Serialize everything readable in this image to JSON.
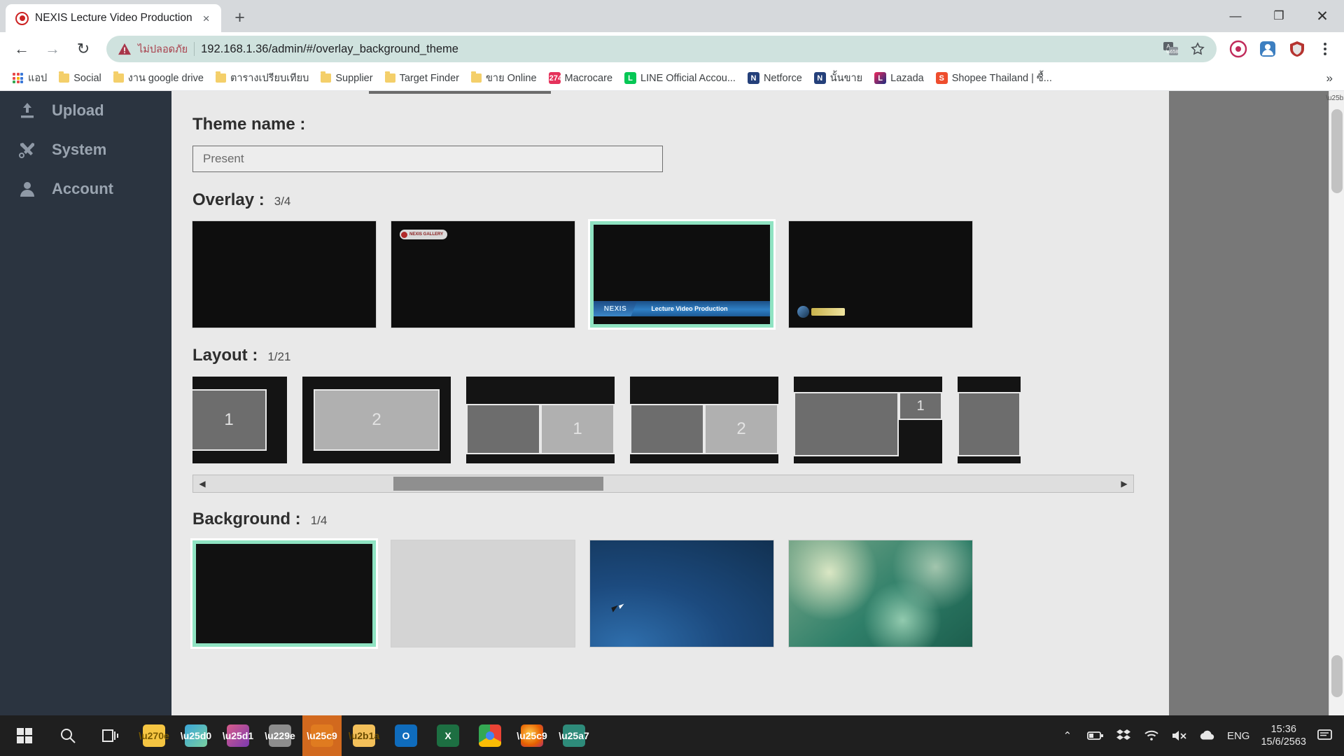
{
  "browser": {
    "tab": {
      "title": "NEXIS Lecture Video Production",
      "favicon": "record-circle-icon",
      "close": "×"
    },
    "new_tab_label": "+",
    "window_controls": {
      "minimize": "—",
      "maximize": "❐",
      "close": "✕"
    },
    "nav": {
      "back": "←",
      "forward": "→",
      "reload": "↻"
    },
    "omnibox": {
      "warning_text": "ไม่ปลอดภัย",
      "url": "192.168.1.36/admin/#/overlay_background_theme",
      "translate_icon": "translate-icon",
      "bookmark_icon": "star-icon"
    },
    "toolbar_right": {
      "ext1": "extension-icon",
      "ext2": "profile-icon",
      "ext3": "shield-icon",
      "menu": "three-dots-icon"
    },
    "bookmarks": [
      {
        "label": "แอป",
        "icon": "apps-grid-icon",
        "color": "#e84a4a"
      },
      {
        "label": "Social",
        "icon": "folder-icon",
        "color": "#f4cf6a"
      },
      {
        "label": "งาน google drive",
        "icon": "folder-icon",
        "color": "#f4cf6a"
      },
      {
        "label": "ตารางเปรียบเทียบ",
        "icon": "folder-icon",
        "color": "#f4cf6a"
      },
      {
        "label": "Supplier",
        "icon": "folder-icon",
        "color": "#f4cf6a"
      },
      {
        "label": "Target Finder",
        "icon": "folder-icon",
        "color": "#f4cf6a"
      },
      {
        "label": "ขาย Online",
        "icon": "folder-icon",
        "color": "#f4cf6a"
      },
      {
        "label": "Macrocare",
        "icon": "macrocare-icon",
        "color": "#e5325b"
      },
      {
        "label": "LINE Official Accou...",
        "icon": "line-icon",
        "color": "#06c755"
      },
      {
        "label": "Netforce",
        "icon": "netforce-icon",
        "color": "#3b5striple"
      },
      {
        "label": "นั้นขาย",
        "icon": "netforce-icon",
        "color": "#2d4a7a"
      },
      {
        "label": "Lazada",
        "icon": "lazada-icon",
        "color": "#f0285a"
      },
      {
        "label": "Shopee Thailand | ซื้...",
        "icon": "shopee-icon",
        "color": "#ee4d2d"
      }
    ],
    "bookmarks_overflow": "»"
  },
  "app": {
    "sidebar": [
      {
        "label": "Upload",
        "icon": "upload-icon"
      },
      {
        "label": "System",
        "icon": "tools-icon"
      },
      {
        "label": "Account",
        "icon": "person-icon"
      }
    ],
    "theme_name": {
      "label": "Theme name :",
      "value": "Present",
      "placeholder": "Theme name"
    },
    "overlay": {
      "label": "Overlay :",
      "count": "3/4",
      "items": [
        {
          "name": "overlay-blank",
          "selected": false,
          "type": "blank"
        },
        {
          "name": "overlay-badge",
          "selected": false,
          "type": "badge",
          "badge_text": "NEXIS GALLERY"
        },
        {
          "name": "overlay-lower-third",
          "selected": true,
          "type": "banner",
          "logo": "NEXIS",
          "banner_text": "Lecture Video Production"
        },
        {
          "name": "overlay-pill",
          "selected": false,
          "type": "pill"
        }
      ]
    },
    "layout": {
      "label": "Layout :",
      "count": "1/21",
      "items": [
        {
          "name": "layout-single-small",
          "labels": [
            "1"
          ]
        },
        {
          "name": "layout-single-wide",
          "labels": [
            "2"
          ]
        },
        {
          "name": "layout-monitor-plus-1",
          "labels": [
            "▣",
            "1"
          ]
        },
        {
          "name": "layout-monitor-plus-2",
          "labels": [
            "▣",
            "2"
          ]
        },
        {
          "name": "layout-monitor-corner-1",
          "labels": [
            "▣",
            "1"
          ]
        },
        {
          "name": "layout-partial",
          "labels": []
        }
      ],
      "scrollbar": {
        "left_arrow": "◀",
        "right_arrow": "▶"
      }
    },
    "background": {
      "label": "Background :",
      "count": "1/4",
      "items": [
        {
          "name": "background-black",
          "selected": true,
          "style": "black"
        },
        {
          "name": "background-gray",
          "selected": false,
          "style": "gray"
        },
        {
          "name": "background-blue",
          "selected": false,
          "style": "blue"
        },
        {
          "name": "background-green",
          "selected": false,
          "style": "green"
        }
      ]
    }
  },
  "taskbar": {
    "start": "windows-icon",
    "search": "search-icon",
    "taskview": "task-view-icon",
    "apps": [
      {
        "name": "sticky-notes-icon",
        "color": "#f5c542",
        "label": "✎"
      },
      {
        "name": "paint-3d-icon",
        "color": "#3aa6d8",
        "label": "◐"
      },
      {
        "name": "paint-icon",
        "color": "#d85c8a",
        "label": "◑"
      },
      {
        "name": "calculator-icon",
        "color": "#8d8d8d",
        "label": "⊞"
      },
      {
        "name": "obs-icon",
        "color": "#d2691e",
        "label": "◉"
      },
      {
        "name": "file-explorer-icon",
        "color": "#f3c05a",
        "label": "⬚"
      },
      {
        "name": "outlook-icon",
        "color": "#0f6cbd",
        "label": "O"
      },
      {
        "name": "excel-icon",
        "color": "#1d6f42",
        "label": "X"
      },
      {
        "name": "chrome-icon",
        "color": "#4285f4",
        "label": "◉"
      },
      {
        "name": "firefox-icon",
        "color": "#e66000",
        "label": "◉"
      },
      {
        "name": "store-icon",
        "color": "#2e8b7a",
        "label": "▧"
      }
    ],
    "tray": {
      "chevron": "⌃",
      "battery": "battery-icon",
      "dropbox": "dropbox-icon",
      "wifi": "wifi-icon",
      "volume": "volume-mute-icon",
      "onedrive": "onedrive-icon",
      "language": "ENG",
      "time": "15:36",
      "date": "15/6/2563",
      "notifications": "notification-icon"
    }
  },
  "colors": {
    "accent_selection": "#8fe3c2",
    "sidebar_bg": "#2b3440",
    "content_bg": "#e9e9e9",
    "omnibox_bg": "#cfe2de",
    "taskbar_bg": "#1f1f1f"
  }
}
